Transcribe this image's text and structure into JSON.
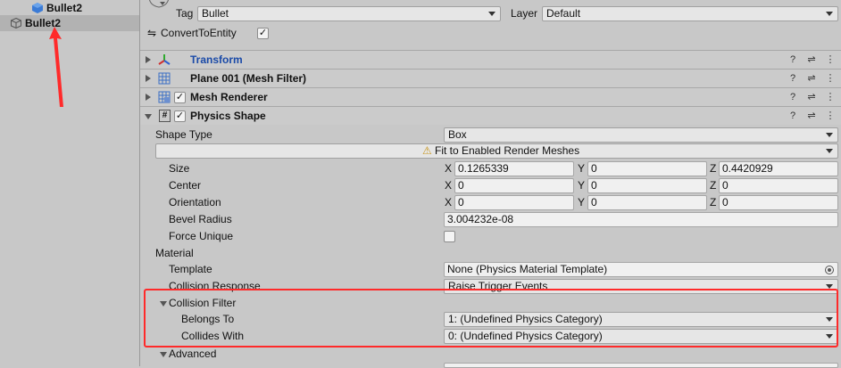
{
  "hierarchy": {
    "items": [
      {
        "label": "Bullet2",
        "selected": false
      },
      {
        "label": "Bullet2",
        "selected": true
      }
    ]
  },
  "inspector": {
    "tag_label": "Tag",
    "tag_value": "Bullet",
    "layer_label": "Layer",
    "layer_value": "Default",
    "convert_label": "ConvertToEntity",
    "convert_checked": "✓",
    "components": [
      {
        "title": "Transform",
        "color": "#1a4aa8"
      },
      {
        "title": "Plane 001 (Mesh Filter)"
      },
      {
        "title": "Mesh Renderer",
        "checked": "✓"
      },
      {
        "title": "Physics Shape",
        "checked": "✓"
      }
    ],
    "header_icons": [
      "help-icon",
      "presets-icon",
      "menu-icon"
    ],
    "header_glyphs": {
      "help": "?",
      "presets": "⇌",
      "menu": "⋮"
    },
    "physics_shape": {
      "shape_type_label": "Shape Type",
      "shape_type_value": "Box",
      "fit_button": "Fit to Enabled Render Meshes",
      "warning_glyph": "⚠",
      "size_label": "Size",
      "size": {
        "x": "0.1265339",
        "y": "0",
        "z": "0.4420929"
      },
      "center_label": "Center",
      "center": {
        "x": "0",
        "y": "0",
        "z": "0"
      },
      "orientation_label": "Orientation",
      "orientation": {
        "x": "0",
        "y": "0",
        "z": "0"
      },
      "bevel_radius_label": "Bevel Radius",
      "bevel_radius_value": "3.004232e-08",
      "force_unique_label": "Force Unique",
      "material_label": "Material",
      "template_label": "Template",
      "template_value": "None (Physics Material Template)",
      "collision_response_label": "Collision Response",
      "collision_response_value": "Raise Trigger Events",
      "collision_filter_label": "Collision Filter",
      "belongs_to_label": "Belongs To",
      "belongs_to_value": "1: (Undefined Physics Category)",
      "collides_with_label": "Collides With",
      "collides_with_value": "0: (Undefined Physics Category)",
      "advanced_label": "Advanced"
    },
    "axis": {
      "x": "X",
      "y": "Y",
      "z": "Z"
    }
  },
  "colors": {
    "annotation": "#ff2a2a",
    "accent": "#1a4aa8"
  }
}
